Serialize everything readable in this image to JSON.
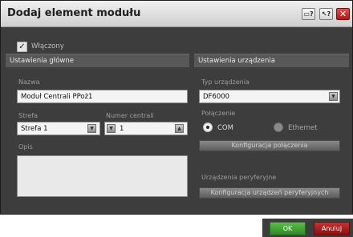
{
  "dialog": {
    "title": "Dodaj element modułu",
    "title_buttons": {
      "window_icon": "▭?",
      "help_icon": "↖?",
      "close_icon": "✕"
    }
  },
  "enabled": {
    "label": "Włączony",
    "checked": true,
    "check_glyph": "✓"
  },
  "left": {
    "header": "Ustawienia główne",
    "name_label": "Nazwa",
    "name_value": "Moduł Centrali PPoż1",
    "zone_label": "Strefa",
    "zone_value": "Strefa 1",
    "central_label": "Numer centrali",
    "central_value": "1",
    "desc_label": "Opis",
    "desc_value": ""
  },
  "right": {
    "header": "Ustawienia urządzenia",
    "device_type_label": "Typ urządzenia",
    "device_type_value": "DF6000",
    "connection_label": "Połączenie",
    "radio_com": "COM",
    "radio_ethernet": "Ethernet",
    "selected_connection": "COM",
    "config_connection_button": "Konfiguracja połączenia",
    "peripherals_label": "Urządzenia peryferyjne",
    "config_peripherals_button": "Konfiguracja urządzeń peryferyjnych"
  },
  "footer": {
    "ok": "OK",
    "cancel": "Anuluj"
  },
  "colors": {
    "ok": "#3fa032",
    "cancel": "#a81c1c",
    "dialog_bg": "#3d3d3d"
  }
}
